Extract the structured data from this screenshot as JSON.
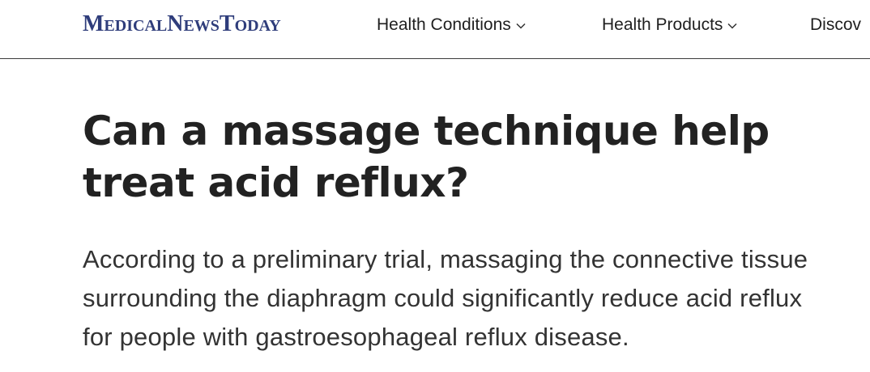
{
  "header": {
    "logo_text": "MedicalNewsToday",
    "brand_color": "#2f3d7b",
    "nav": [
      {
        "label": "Health Conditions",
        "icon": "chevron-down-icon"
      },
      {
        "label": "Health Products",
        "icon": "chevron-down-icon"
      },
      {
        "label": "Discov"
      }
    ]
  },
  "article": {
    "title": "Can a massage technique help treat acid reflux?",
    "dek": "According to a preliminary trial, massaging the connective tissue surrounding the diaphragm could significantly reduce acid reflux for people with gastroesophageal reflux disease."
  }
}
